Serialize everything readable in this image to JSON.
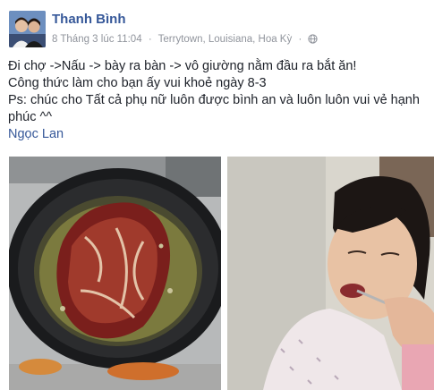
{
  "post": {
    "author": "Thanh Bình",
    "timestamp": "8 Tháng 3 lúc 11:04",
    "separator": "·",
    "location": "Terrytown, Louisiana, Hoa Kỳ",
    "privacy_icon": "globe-icon",
    "lines": [
      "Đi chợ ->Nấu -> bày ra bàn -> vô giường nằm đầu ra bắt ăn!",
      "Công thức làm cho bạn ấy vui khoẻ ngày 8-3",
      "Ps: chúc cho Tất cả phụ nữ luôn được bình an và luôn luôn vui vẻ hạnh phúc ^^"
    ],
    "mention": "Ngọc Lan"
  },
  "colors": {
    "link": "#365899",
    "meta": "#90949c",
    "text": "#1d2129"
  }
}
